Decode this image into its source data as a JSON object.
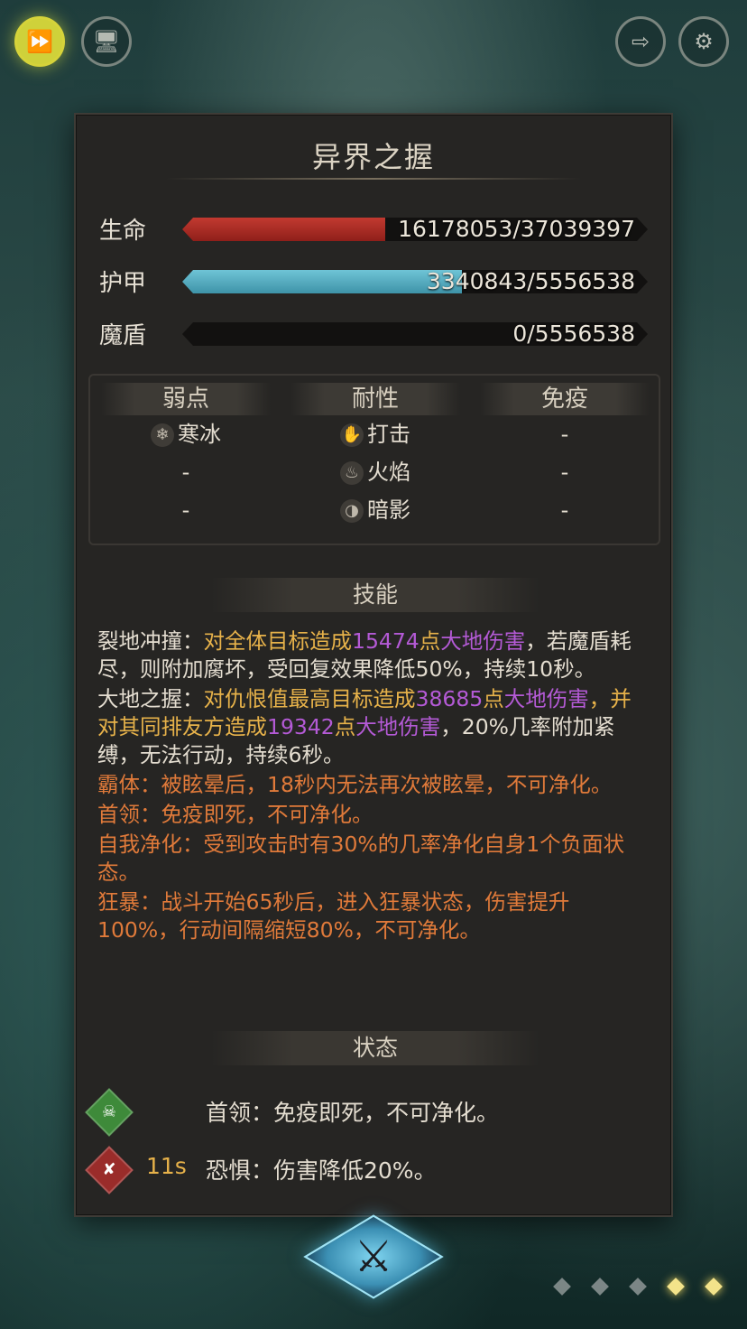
{
  "panel": {
    "title": "异界之握",
    "stats": {
      "hp": {
        "label": "生命",
        "text": "16178053/37039397",
        "fraction": 0.437
      },
      "armor": {
        "label": "护甲",
        "text": "3340843/5556538",
        "fraction": 0.601
      },
      "magic_shield": {
        "label": "魔盾",
        "text": "0/5556538",
        "fraction": 0.0
      }
    },
    "traits": {
      "weakness": {
        "header": "弱点",
        "items": [
          "寒冰",
          "-",
          "-"
        ]
      },
      "resistance": {
        "header": "耐性",
        "items": [
          "打击",
          "火焰",
          "暗影"
        ]
      },
      "immunity": {
        "header": "免疫",
        "items": [
          "-",
          "-",
          "-"
        ]
      }
    },
    "skills_header": "技能",
    "skills": {
      "s1": {
        "name": "裂地冲撞：",
        "t1": "对全体目标造成",
        "n1": "15474",
        "t2": "点",
        "dmg1": "大地伤害",
        "t3": "，若魔盾耗尽，则附加腐坏，受回复效果降低50%，持续10秒。"
      },
      "s2": {
        "name": "大地之握：",
        "t1": "对仇恨值最高目标造成",
        "n1": "38685",
        "t2": "点",
        "dmg1": "大地伤害",
        "t3": "，并对其同排友方造成",
        "n2": "19342",
        "t4": "点",
        "dmg2": "大地伤害",
        "t5": "，20%几率附加紧缚，无法行动，持续6秒。"
      },
      "s3": "霸体：被眩晕后，18秒内无法再次被眩晕，不可净化。",
      "s4": "首领：免疫即死，不可净化。",
      "s5": "自我净化：受到攻击时有30%的几率净化自身1个负面状态。",
      "s6": "狂暴：战斗开始65秒后，进入狂暴状态，伤害提升100%，行动间隔缩短80%，不可净化。"
    },
    "status_header": "状态",
    "statuses": [
      {
        "icon": "skull-icon",
        "time": "",
        "text": "首领：免疫即死，不可净化。",
        "color": "#3e8a3a"
      },
      {
        "icon": "fear-icon",
        "time": "11s",
        "text": "恐惧：伤害降低20%。",
        "color": "#9a2c2a"
      }
    ]
  },
  "colors": {
    "hp": "#c23a30",
    "armor": "#6fc4d6",
    "highlight_purple": "#b45ad6",
    "highlight_orange": "#e7b24a",
    "passive_orange": "#e07a3a"
  },
  "pager": {
    "active_from": 3,
    "total": 5
  }
}
